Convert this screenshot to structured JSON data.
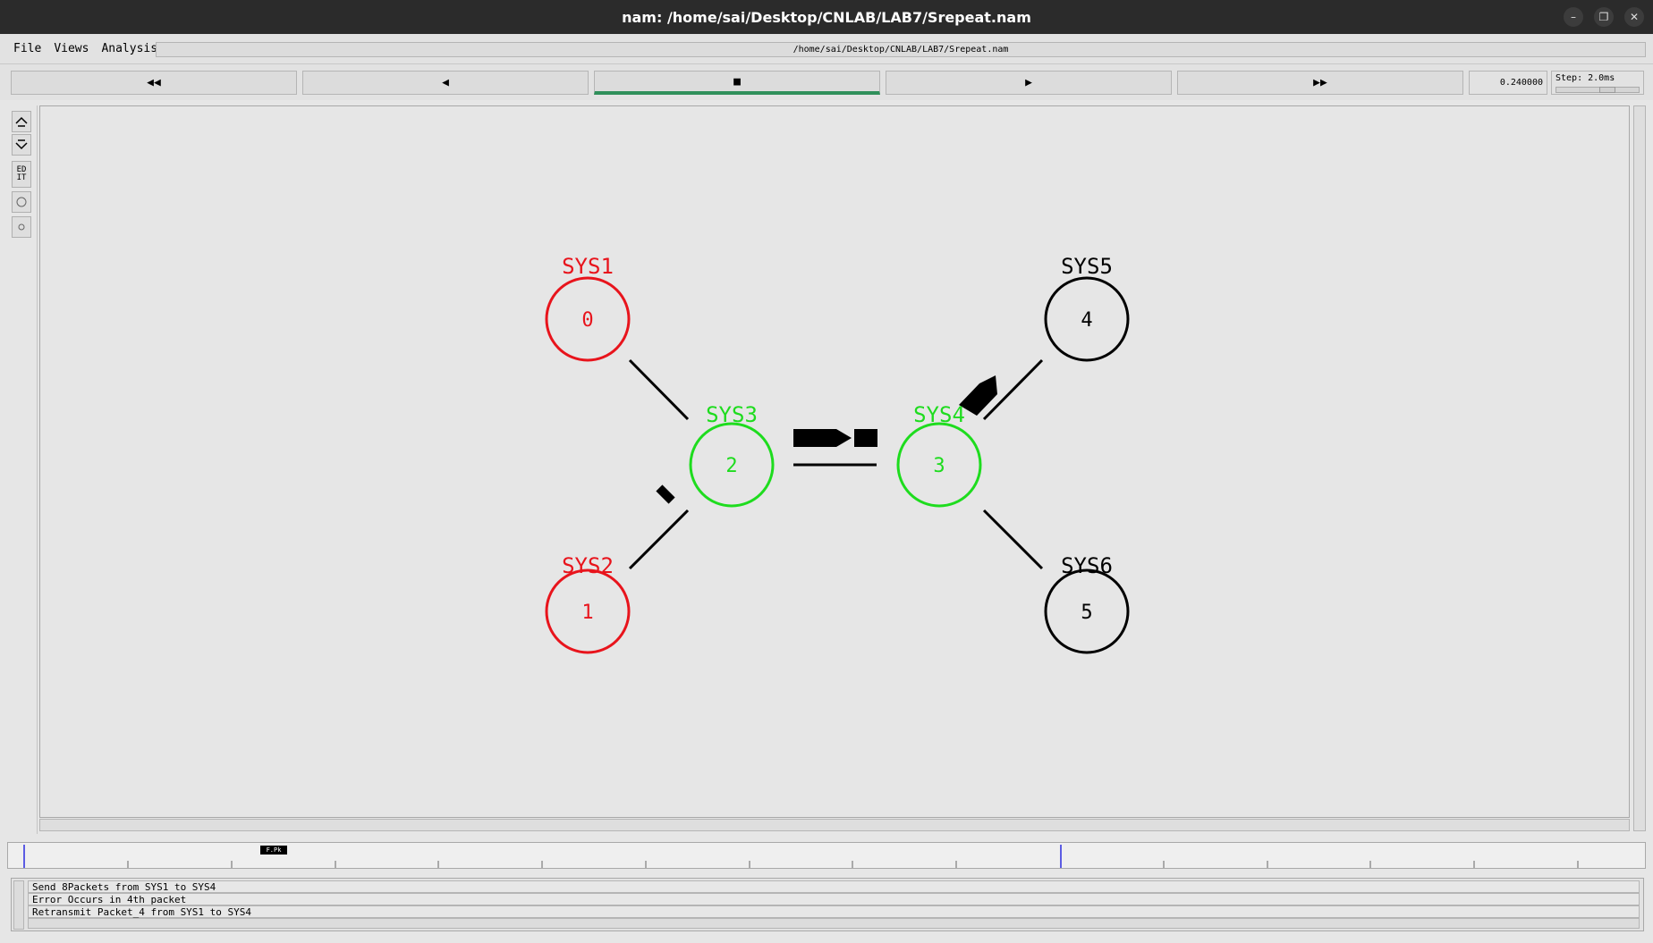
{
  "window": {
    "title": "nam: /home/sai/Desktop/CNLAB/LAB7/Srepeat.nam",
    "controls": [
      "minimize-icon",
      "restore-icon",
      "close-icon"
    ]
  },
  "menu": {
    "file": "File",
    "views": "Views",
    "analysis": "Analysis",
    "path": "/home/sai/Desktop/CNLAB/LAB7/Srepeat.nam"
  },
  "toolbar": {
    "rewind": "◀◀",
    "back": "◀",
    "stop": "■",
    "play": "▶",
    "fast_forward": "▶▶",
    "active": "stop",
    "time": "0.240000",
    "step": "Step: 2.0ms"
  },
  "left_tools": {
    "edit": "ED\nIT"
  },
  "network": {
    "nodes": [
      {
        "id": "0",
        "label": "SYS1",
        "color": "#e8141c"
      },
      {
        "id": "1",
        "label": "SYS2",
        "color": "#e8141c"
      },
      {
        "id": "2",
        "label": "SYS3",
        "color": "#1edc1e"
      },
      {
        "id": "3",
        "label": "SYS4",
        "color": "#1edc1e"
      },
      {
        "id": "4",
        "label": "SYS5",
        "color": "#000000"
      },
      {
        "id": "5",
        "label": "SYS6",
        "color": "#000000"
      }
    ],
    "links": [
      [
        "0",
        "2"
      ],
      [
        "1",
        "2"
      ],
      [
        "2",
        "3"
      ],
      [
        "3",
        "4"
      ],
      [
        "3",
        "5"
      ]
    ]
  },
  "timeline": {
    "marker": "F.Pk"
  },
  "annotations": [
    "Send 8Packets from SYS1 to SYS4",
    "Error Occurs in 4th packet",
    "Retransmit Packet_4 from SYS1 to SYS4"
  ]
}
